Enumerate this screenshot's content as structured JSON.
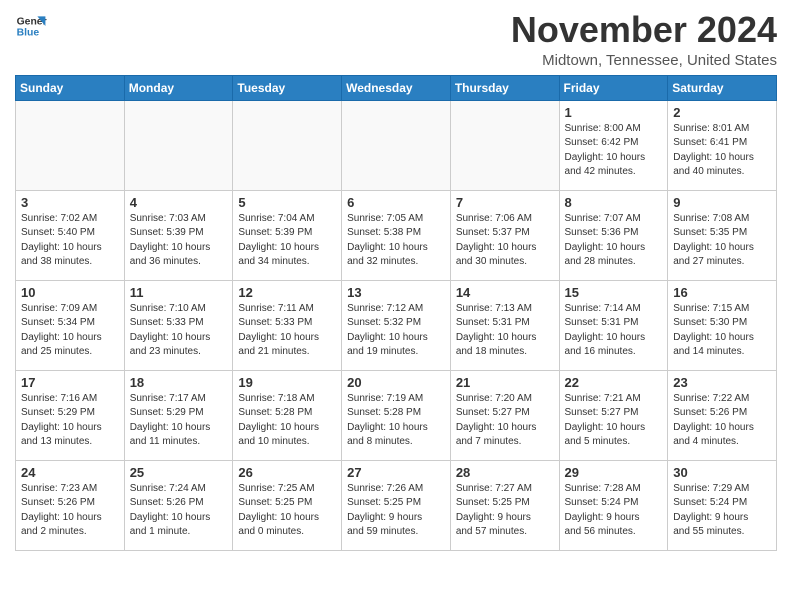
{
  "logo": {
    "general": "General",
    "blue": "Blue"
  },
  "title": "November 2024",
  "location": "Midtown, Tennessee, United States",
  "weekdays": [
    "Sunday",
    "Monday",
    "Tuesday",
    "Wednesday",
    "Thursday",
    "Friday",
    "Saturday"
  ],
  "weeks": [
    [
      {
        "day": "",
        "info": ""
      },
      {
        "day": "",
        "info": ""
      },
      {
        "day": "",
        "info": ""
      },
      {
        "day": "",
        "info": ""
      },
      {
        "day": "",
        "info": ""
      },
      {
        "day": "1",
        "info": "Sunrise: 8:00 AM\nSunset: 6:42 PM\nDaylight: 10 hours\nand 42 minutes."
      },
      {
        "day": "2",
        "info": "Sunrise: 8:01 AM\nSunset: 6:41 PM\nDaylight: 10 hours\nand 40 minutes."
      }
    ],
    [
      {
        "day": "3",
        "info": "Sunrise: 7:02 AM\nSunset: 5:40 PM\nDaylight: 10 hours\nand 38 minutes."
      },
      {
        "day": "4",
        "info": "Sunrise: 7:03 AM\nSunset: 5:39 PM\nDaylight: 10 hours\nand 36 minutes."
      },
      {
        "day": "5",
        "info": "Sunrise: 7:04 AM\nSunset: 5:39 PM\nDaylight: 10 hours\nand 34 minutes."
      },
      {
        "day": "6",
        "info": "Sunrise: 7:05 AM\nSunset: 5:38 PM\nDaylight: 10 hours\nand 32 minutes."
      },
      {
        "day": "7",
        "info": "Sunrise: 7:06 AM\nSunset: 5:37 PM\nDaylight: 10 hours\nand 30 minutes."
      },
      {
        "day": "8",
        "info": "Sunrise: 7:07 AM\nSunset: 5:36 PM\nDaylight: 10 hours\nand 28 minutes."
      },
      {
        "day": "9",
        "info": "Sunrise: 7:08 AM\nSunset: 5:35 PM\nDaylight: 10 hours\nand 27 minutes."
      }
    ],
    [
      {
        "day": "10",
        "info": "Sunrise: 7:09 AM\nSunset: 5:34 PM\nDaylight: 10 hours\nand 25 minutes."
      },
      {
        "day": "11",
        "info": "Sunrise: 7:10 AM\nSunset: 5:33 PM\nDaylight: 10 hours\nand 23 minutes."
      },
      {
        "day": "12",
        "info": "Sunrise: 7:11 AM\nSunset: 5:33 PM\nDaylight: 10 hours\nand 21 minutes."
      },
      {
        "day": "13",
        "info": "Sunrise: 7:12 AM\nSunset: 5:32 PM\nDaylight: 10 hours\nand 19 minutes."
      },
      {
        "day": "14",
        "info": "Sunrise: 7:13 AM\nSunset: 5:31 PM\nDaylight: 10 hours\nand 18 minutes."
      },
      {
        "day": "15",
        "info": "Sunrise: 7:14 AM\nSunset: 5:31 PM\nDaylight: 10 hours\nand 16 minutes."
      },
      {
        "day": "16",
        "info": "Sunrise: 7:15 AM\nSunset: 5:30 PM\nDaylight: 10 hours\nand 14 minutes."
      }
    ],
    [
      {
        "day": "17",
        "info": "Sunrise: 7:16 AM\nSunset: 5:29 PM\nDaylight: 10 hours\nand 13 minutes."
      },
      {
        "day": "18",
        "info": "Sunrise: 7:17 AM\nSunset: 5:29 PM\nDaylight: 10 hours\nand 11 minutes."
      },
      {
        "day": "19",
        "info": "Sunrise: 7:18 AM\nSunset: 5:28 PM\nDaylight: 10 hours\nand 10 minutes."
      },
      {
        "day": "20",
        "info": "Sunrise: 7:19 AM\nSunset: 5:28 PM\nDaylight: 10 hours\nand 8 minutes."
      },
      {
        "day": "21",
        "info": "Sunrise: 7:20 AM\nSunset: 5:27 PM\nDaylight: 10 hours\nand 7 minutes."
      },
      {
        "day": "22",
        "info": "Sunrise: 7:21 AM\nSunset: 5:27 PM\nDaylight: 10 hours\nand 5 minutes."
      },
      {
        "day": "23",
        "info": "Sunrise: 7:22 AM\nSunset: 5:26 PM\nDaylight: 10 hours\nand 4 minutes."
      }
    ],
    [
      {
        "day": "24",
        "info": "Sunrise: 7:23 AM\nSunset: 5:26 PM\nDaylight: 10 hours\nand 2 minutes."
      },
      {
        "day": "25",
        "info": "Sunrise: 7:24 AM\nSunset: 5:26 PM\nDaylight: 10 hours\nand 1 minute."
      },
      {
        "day": "26",
        "info": "Sunrise: 7:25 AM\nSunset: 5:25 PM\nDaylight: 10 hours\nand 0 minutes."
      },
      {
        "day": "27",
        "info": "Sunrise: 7:26 AM\nSunset: 5:25 PM\nDaylight: 9 hours\nand 59 minutes."
      },
      {
        "day": "28",
        "info": "Sunrise: 7:27 AM\nSunset: 5:25 PM\nDaylight: 9 hours\nand 57 minutes."
      },
      {
        "day": "29",
        "info": "Sunrise: 7:28 AM\nSunset: 5:24 PM\nDaylight: 9 hours\nand 56 minutes."
      },
      {
        "day": "30",
        "info": "Sunrise: 7:29 AM\nSunset: 5:24 PM\nDaylight: 9 hours\nand 55 minutes."
      }
    ]
  ]
}
